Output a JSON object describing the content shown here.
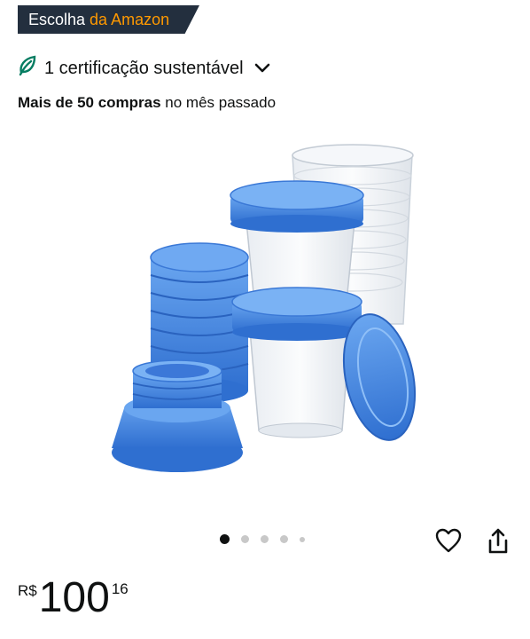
{
  "badge": {
    "part1": "Escolha",
    "part2": "da Amazon"
  },
  "certification": {
    "label": "1 certificação sustentável",
    "icon": "leaf-icon"
  },
  "bought": {
    "bold": "Mais de 50 compras",
    "rest": " no mês passado"
  },
  "carousel": {
    "image_count": 5,
    "active_index": 0
  },
  "price": {
    "currency": "R$",
    "whole": "100",
    "fraction": "16"
  },
  "colors": {
    "badge_bg": "#232f3e",
    "badge_accent": "#ff9900",
    "leaf": "#067d62",
    "cap_blue": "#3f7fd9"
  }
}
